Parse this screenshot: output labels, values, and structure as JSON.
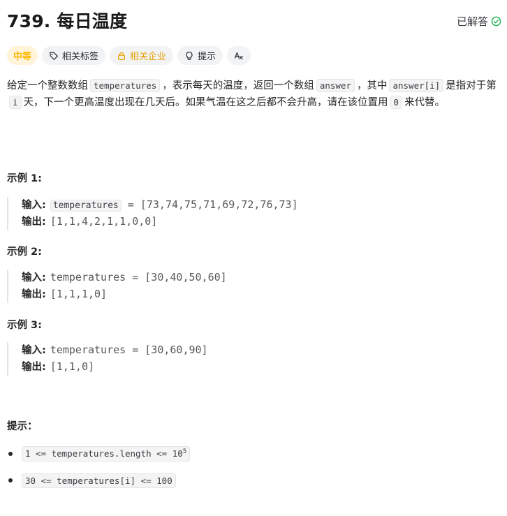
{
  "problem": {
    "title": "739. 每日温度",
    "status": "已解答",
    "success_color": "#2db55d"
  },
  "tags": [
    {
      "label": "中等",
      "icon": ""
    },
    {
      "label": "相关标签",
      "icon": "tag-icon"
    },
    {
      "label": "相关企业",
      "icon": "lock-icon"
    },
    {
      "label": "提示",
      "icon": "lightbulb-icon"
    },
    {
      "label": "",
      "icon": "translate-icon"
    }
  ],
  "description": {
    "p1": "给定一个整数数组",
    "c1": "temperatures",
    "p2": "，表示每天的温度，返回一个数组",
    "c2": "answer",
    "p3": "，其中",
    "c3": "answer[i]",
    "p4": "是指对于第",
    "c4": "i",
    "p5": "天，下一个更高温度出现在几天后。如果气温在这之后都不会升高，请在该位置用",
    "c5": "0",
    "p6": "来代替。"
  },
  "examples": [
    {
      "title": "示例 1:",
      "input_label": "输入:",
      "input_var": "temperatures",
      "input_rest": " = [73,74,75,71,69,72,76,73]",
      "output_label": "输出:",
      "output": "[1,1,4,2,1,1,0,0]"
    },
    {
      "title": "示例 2:",
      "input_label": "输入:",
      "input_var": "temperatures",
      "input_rest": " = [30,40,50,60]",
      "output_label": "输出:",
      "output": "[1,1,1,0]"
    },
    {
      "title": "示例 3:",
      "input_label": "输入:",
      "input_var": "temperatures",
      "input_rest": " = [30,60,90]",
      "output_label": "输出:",
      "output": "[1,1,0]"
    }
  ],
  "hints": {
    "title": "提示：",
    "items": [
      {
        "text": "1 <= temperatures.length <= 10",
        "sup": "5"
      },
      {
        "text": "30 <= temperatures[i] <= 100",
        "sup": ""
      }
    ]
  }
}
